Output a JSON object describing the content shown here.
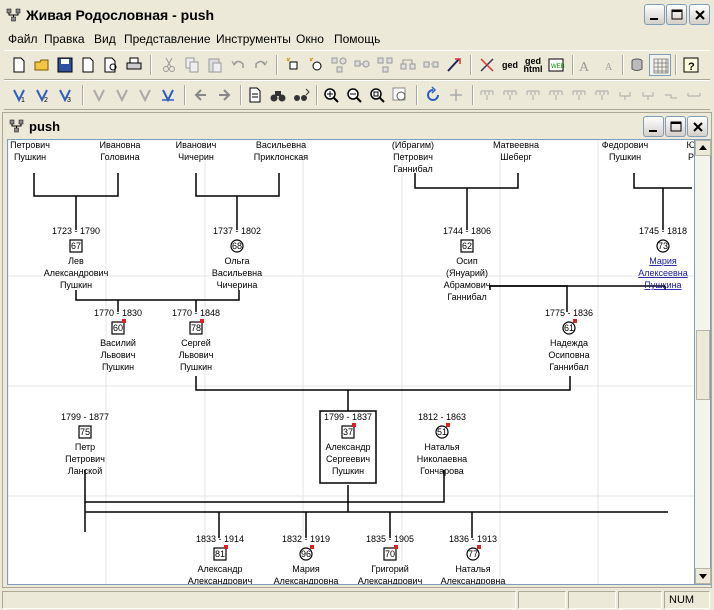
{
  "window": {
    "title": "Живая Родословная - push"
  },
  "menu": [
    "Файл",
    "Правка",
    "Вид",
    "Представление",
    "Инструменты",
    "Окно",
    "Помощь"
  ],
  "toolbar": {
    "ged_label": "ged",
    "gedhtml_label_1": "ged",
    "gedhtml_label_2": "html"
  },
  "child": {
    "title": "push"
  },
  "tree": {
    "top_names": [
      {
        "l1": "Петрович",
        "l2": "Пушкин"
      },
      {
        "l1": "Ивановна",
        "l2": "Головина"
      },
      {
        "l1": "Иванович",
        "l2": "Чичерин"
      },
      {
        "l1": "Васильевна",
        "l2": "Приклонская"
      },
      {
        "l1": "(Ибрагим)",
        "l2": "Петрович",
        "l3": "Ганнибал"
      },
      {
        "l1": "Матвеевна",
        "l2": "Шеберг"
      },
      {
        "l1": "Федорович",
        "l2": "Пушкин"
      },
      {
        "l1": "Ю",
        "l2": "Р"
      }
    ],
    "people": [
      {
        "id": "lev",
        "years": "1723 - 1790",
        "num": "67",
        "names": [
          "Лев",
          "Александрович",
          "Пушкин"
        ],
        "female": false,
        "marked": false
      },
      {
        "id": "olga",
        "years": "1737 - 1802",
        "num": "68",
        "names": [
          "Ольга",
          "Васильевна",
          "Чичерина"
        ],
        "female": true,
        "marked": false
      },
      {
        "id": "osip",
        "years": "1744 - 1806",
        "num": "62",
        "names": [
          "Осип",
          "(Януарий)",
          "Абрамович",
          "Ганнибал"
        ],
        "female": false,
        "marked": false
      },
      {
        "id": "maria",
        "years": "1745 - 1818",
        "num": "73",
        "names": [
          "Мария",
          "Алексеевна",
          "Пушкина"
        ],
        "female": true,
        "marked": false,
        "link": true
      },
      {
        "id": "vasily",
        "years": "1770 - 1830",
        "num": "60",
        "names": [
          "Василий",
          "Львович",
          "Пушкин"
        ],
        "female": false,
        "marked": true
      },
      {
        "id": "sergey",
        "years": "1770 - 1848",
        "num": "78",
        "names": [
          "Сергей",
          "Львович",
          "Пушкин"
        ],
        "female": false,
        "marked": true
      },
      {
        "id": "nadezhda",
        "years": "1775 - 1836",
        "num": "61",
        "names": [
          "Надежда",
          "Осиповна",
          "Ганнибал"
        ],
        "female": true,
        "marked": true
      },
      {
        "id": "petr",
        "years": "1799 - 1877",
        "num": "75",
        "names": [
          "Петр",
          "Петрович",
          "Ланской"
        ],
        "female": false,
        "marked": false
      },
      {
        "id": "alexander",
        "years": "1799 - 1837",
        "num": "37",
        "names": [
          "Александр",
          "Сергеевич",
          "Пушкин"
        ],
        "female": false,
        "marked": true,
        "selected": true
      },
      {
        "id": "natalia",
        "years": "1812 - 1863",
        "num": "51",
        "names": [
          "Наталья",
          "Николаевна",
          "Гончарова"
        ],
        "female": true,
        "marked": true
      },
      {
        "id": "alexander2",
        "years": "1833 - 1914",
        "num": "81",
        "names": [
          "Александр",
          "Александрович"
        ],
        "female": false,
        "marked": true
      },
      {
        "id": "maria2",
        "years": "1832 - 1919",
        "num": "96",
        "names": [
          "Мария",
          "Александровна"
        ],
        "female": true,
        "marked": true
      },
      {
        "id": "grigory",
        "years": "1835 - 1905",
        "num": "70",
        "names": [
          "Григорий",
          "Александрович"
        ],
        "female": false,
        "marked": true
      },
      {
        "id": "natalia2",
        "years": "1836 - 1913",
        "num": "77",
        "names": [
          "Наталья",
          "Александровна"
        ],
        "female": true,
        "marked": true
      }
    ]
  },
  "status": {
    "num": "NUM"
  }
}
